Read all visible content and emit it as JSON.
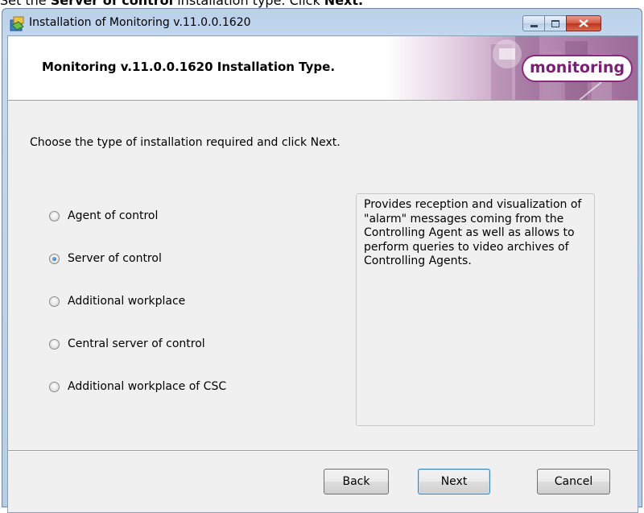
{
  "caption": {
    "prefix": "Set the",
    "bold": "Server of control",
    "middle": "installation type. Click",
    "bold2": "Next."
  },
  "window": {
    "title": "Installation of Monitoring v.11.0.0.1620",
    "banner_title": "Monitoring v.11.0.0.1620 Installation Type.",
    "logo_text": "monitoring"
  },
  "main": {
    "instruction": "Choose the type of installation required and click Next.",
    "options": [
      {
        "label": "Agent of control",
        "checked": false
      },
      {
        "label": "Server of control",
        "checked": true
      },
      {
        "label": "Additional workplace",
        "checked": false
      },
      {
        "label": "Central server of control",
        "checked": false
      },
      {
        "label": "Additional workplace of CSC",
        "checked": false
      }
    ],
    "description": "Provides reception and visualization of \"alarm\" messages coming from the Controlling Agent as well as allows to perform queries to video archives of Controlling Agents."
  },
  "buttons": {
    "back": "Back",
    "next": "Next",
    "cancel": "Cancel"
  },
  "colors": {
    "accent": "#7a2070",
    "window_frame": "#b9d1ea",
    "close": "#c0321c"
  }
}
